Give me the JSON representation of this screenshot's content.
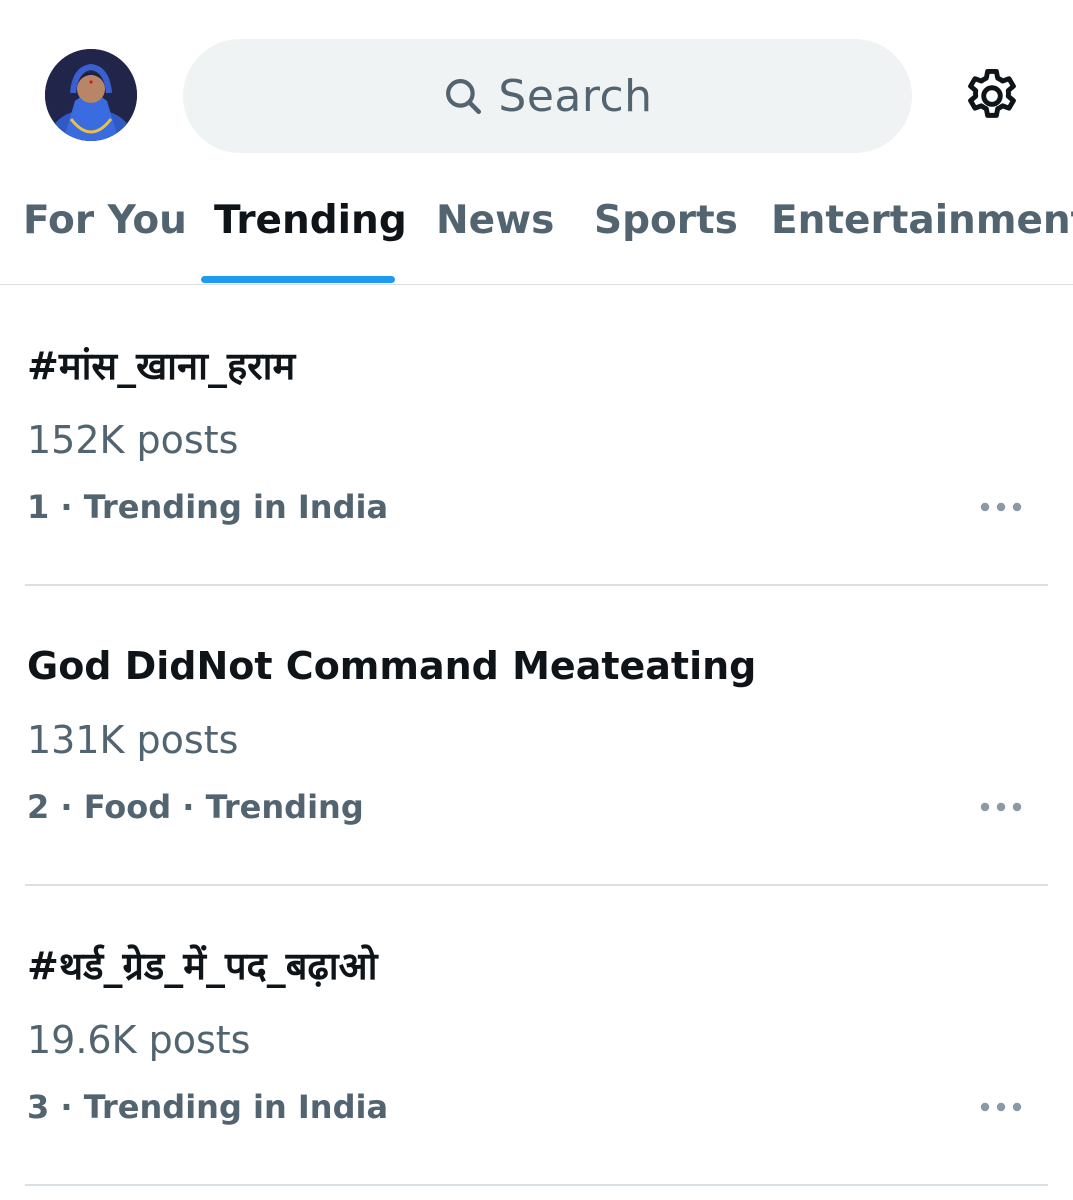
{
  "header": {
    "avatar_alt": "profile avatar",
    "search_placeholder": "Search",
    "settings_icon": "gear-icon"
  },
  "tabs": [
    {
      "label": "For You",
      "active": false
    },
    {
      "label": "Trending",
      "active": true
    },
    {
      "label": "News",
      "active": false
    },
    {
      "label": "Sports",
      "active": false
    },
    {
      "label": "Entertainment",
      "active": false
    }
  ],
  "trends": [
    {
      "name": "#मांस_खाना_हराम",
      "count": "152K posts",
      "context": "1 · Trending in India"
    },
    {
      "name": "God DidNot Command Meateating",
      "count": "131K posts",
      "context": "2 · Food · Trending"
    },
    {
      "name": "#थर्ड_ग्रेड_में_पद_बढ़ाओ",
      "count": "19.6K posts",
      "context": "3 · Trending in India"
    }
  ],
  "colors": {
    "accent": "#1d9bf0",
    "primary_text": "#0f1419",
    "secondary_text": "#536471",
    "search_bg": "#eff3f4",
    "divider": "#d9dfe3"
  }
}
